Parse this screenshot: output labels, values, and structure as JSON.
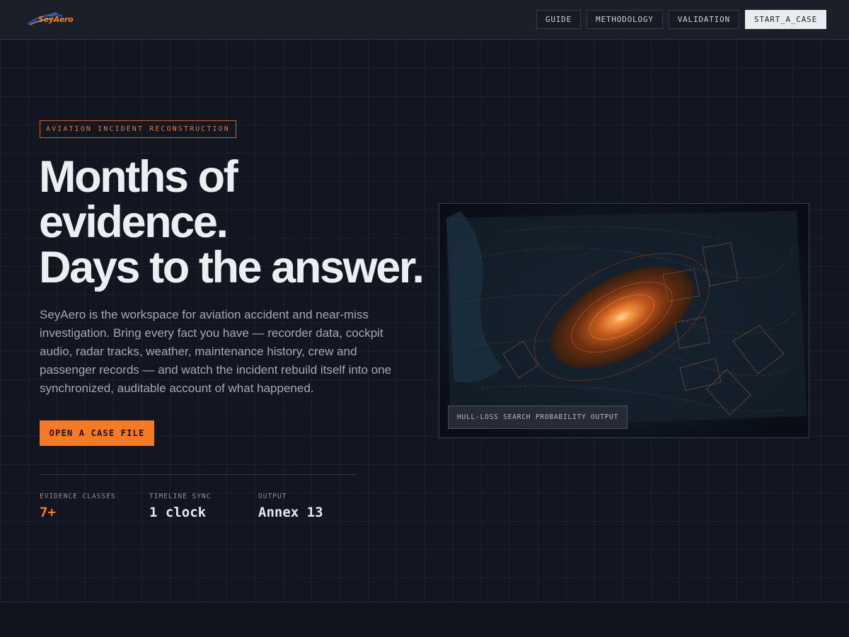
{
  "brand": {
    "logo_text": "SeyAero",
    "accent": "#f47a26"
  },
  "nav": {
    "items": [
      {
        "label": "GUIDE"
      },
      {
        "label": "METHODOLOGY"
      },
      {
        "label": "VALIDATION"
      }
    ],
    "primary_label": "START_A_CASE"
  },
  "hero": {
    "eyebrow": "AVIATION INCIDENT RECONSTRUCTION",
    "headline_lines": [
      "Months of",
      "evidence.",
      "Days to the answer."
    ],
    "lede": "SeyAero is the workspace for aviation accident and near-miss investigation. Bring every fact you have — recorder data, cockpit audio, radar tracks, weather, maintenance history, crew and passenger records — and watch the incident rebuild itself into one synchronized, auditable account of what happened.",
    "cta_label": "OPEN A CASE FILE",
    "stats": [
      {
        "label": "EVIDENCE CLASSES",
        "value": "7+"
      },
      {
        "label": "TIMELINE SYNC",
        "value": "1 clock"
      },
      {
        "label": "OUTPUT",
        "value": "Annex 13"
      }
    ]
  },
  "visual": {
    "caption": "HULL-LOSS SEARCH PROBABILITY OUTPUT",
    "icon": "search-probability-heatmap"
  }
}
